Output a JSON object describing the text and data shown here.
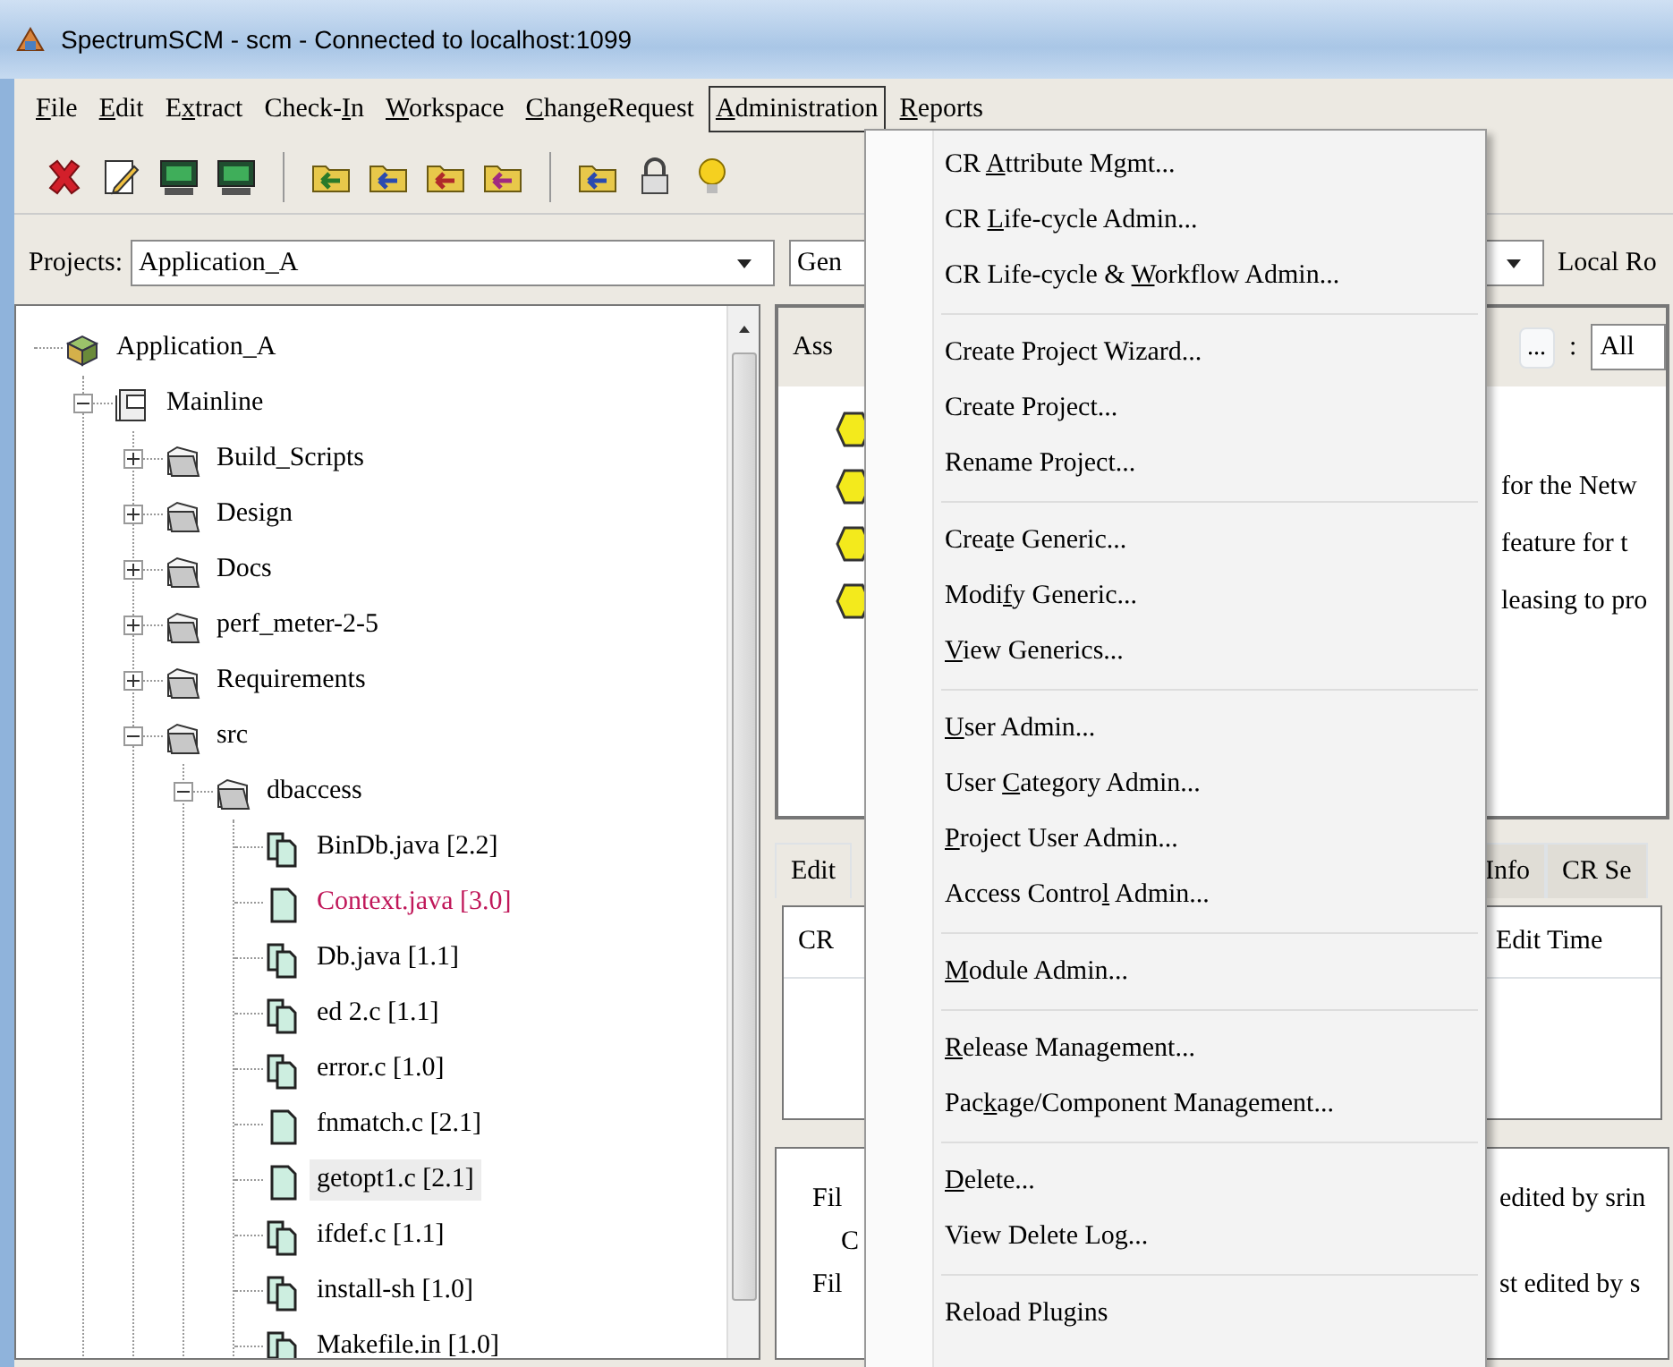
{
  "window": {
    "title": "SpectrumSCM - scm - Connected to localhost:1099"
  },
  "menu_bar": [
    {
      "label": {
        "key": "F",
        "after": "ile"
      },
      "selected": false
    },
    {
      "label": {
        "key": "E",
        "after": "dit"
      },
      "selected": false
    },
    {
      "label": {
        "before": "E",
        "key": "x",
        "after": "tract"
      },
      "selected": false
    },
    {
      "label": {
        "before": "Check-",
        "key": "I",
        "after": "n"
      },
      "selected": false
    },
    {
      "label": {
        "key": "W",
        "after": "orkspace"
      },
      "selected": false
    },
    {
      "label": {
        "key": "C",
        "after": "hangeRequest"
      },
      "selected": false
    },
    {
      "label": {
        "key": "A",
        "after": "dministration"
      },
      "selected": true
    },
    {
      "label": {
        "key": "R",
        "after": "eports"
      },
      "selected": false
    }
  ],
  "projects": {
    "label": "Projects:",
    "value": "Application_A"
  },
  "generic_combo": {
    "value": "Gen"
  },
  "local_root": {
    "label": "Local Ro"
  },
  "tree": [
    {
      "label": "Application_A",
      "kind": "project",
      "children": [
        {
          "label": "Mainline",
          "kind": "branch",
          "expanded": true,
          "children": [
            {
              "label": "Build_Scripts",
              "kind": "folder",
              "expanded": false
            },
            {
              "label": "Design",
              "kind": "folder",
              "expanded": false
            },
            {
              "label": "Docs",
              "kind": "folder",
              "expanded": false
            },
            {
              "label": "perf_meter-2-5",
              "kind": "folder",
              "expanded": false
            },
            {
              "label": "Requirements",
              "kind": "folder",
              "expanded": false
            },
            {
              "label": "src",
              "kind": "folder",
              "expanded": true,
              "children": [
                {
                  "label": "dbaccess",
                  "kind": "folder",
                  "expanded": true,
                  "children": [
                    {
                      "label": "BinDb.java [2.2]",
                      "kind": "file-versions",
                      "selected": false,
                      "color": "#000000"
                    },
                    {
                      "label": "Context.java [3.0]",
                      "kind": "file",
                      "selected": false,
                      "color": "#c0185a"
                    },
                    {
                      "label": "Db.java [1.1]",
                      "kind": "file-versions",
                      "selected": false,
                      "color": "#000000"
                    },
                    {
                      "label": "ed 2.c [1.1]",
                      "kind": "file-versions",
                      "selected": false,
                      "color": "#000000"
                    },
                    {
                      "label": "error.c [1.0]",
                      "kind": "file-versions",
                      "selected": false,
                      "color": "#000000"
                    },
                    {
                      "label": "fnmatch.c [2.1]",
                      "kind": "file",
                      "selected": false,
                      "color": "#000000"
                    },
                    {
                      "label": "getopt1.c [2.1]",
                      "kind": "file",
                      "selected": true,
                      "color": "#000000"
                    },
                    {
                      "label": "ifdef.c [1.1]",
                      "kind": "file-versions",
                      "selected": false,
                      "color": "#000000"
                    },
                    {
                      "label": "install-sh [1.0]",
                      "kind": "file-versions",
                      "selected": false,
                      "color": "#000000"
                    },
                    {
                      "label": "Makefile.in [1.0]",
                      "kind": "file-versions",
                      "selected": false,
                      "color": "#000000"
                    }
                  ]
                }
              ]
            }
          ]
        }
      ]
    }
  ],
  "assignments_panel": {
    "label": "Ass",
    "browse_button": "...",
    "separator": ":",
    "filter": "All",
    "items": [
      {
        "kind": "cr"
      },
      {
        "kind": "cr",
        "text": "for the Netw"
      },
      {
        "kind": "cr",
        "text": "feature for t"
      },
      {
        "kind": "cr",
        "text": "leasing to pro"
      }
    ]
  },
  "tabs": [
    {
      "label": "Edit",
      "selected": true
    },
    {
      "label": "Info",
      "selected": false
    },
    {
      "label": "CR Se",
      "selected": false
    }
  ],
  "table": {
    "columns": [
      "CR",
      "Edit Time"
    ]
  },
  "details": [
    {
      "label": "Fil",
      "text": "edited by srin"
    },
    {
      "label": "C"
    },
    {
      "label": "Fil",
      "text": "st edited by s"
    }
  ],
  "dropdown_menu": [
    [
      {
        "label": {
          "before": "CR ",
          "key": "A",
          "after": "ttribute Mgmt..."
        }
      },
      {
        "label": {
          "before": "CR ",
          "key": "L",
          "after": "ife-cycle Admin..."
        }
      },
      {
        "label": {
          "before": "CR Life-cycle & ",
          "key": "W",
          "after": "orkflow Admin..."
        }
      }
    ],
    [
      {
        "label": {
          "before": "Create Project Wizard..."
        }
      },
      {
        "label": {
          "before": "Create Project..."
        }
      },
      {
        "label": {
          "before": "Rename Project..."
        }
      }
    ],
    [
      {
        "label": {
          "before": "Crea",
          "key": "t",
          "after": "e Generic..."
        }
      },
      {
        "label": {
          "before": "Modi",
          "key": "f",
          "after": "y Generic..."
        }
      },
      {
        "label": {
          "key": "V",
          "after": "iew Generics..."
        }
      }
    ],
    [
      {
        "label": {
          "key": "U",
          "after": "ser Admin..."
        }
      },
      {
        "label": {
          "before": "User ",
          "key": "C",
          "after": "ategory Admin..."
        }
      },
      {
        "label": {
          "key": "P",
          "after": "roject User Admin..."
        }
      },
      {
        "label": {
          "before": "Access Contro",
          "key": "l",
          "after": " Admin..."
        }
      }
    ],
    [
      {
        "label": {
          "key": "M",
          "after": "odule Admin..."
        }
      }
    ],
    [
      {
        "label": {
          "key": "R",
          "after": "elease Management..."
        }
      },
      {
        "label": {
          "before": "Pac",
          "key": "k",
          "after": "age/Component Management..."
        }
      }
    ],
    [
      {
        "label": {
          "key": "D",
          "after": "elete..."
        }
      },
      {
        "label": {
          "before": "View Delete Log..."
        }
      }
    ],
    [
      {
        "label": {
          "before": "Reload Plugins"
        }
      }
    ]
  ]
}
